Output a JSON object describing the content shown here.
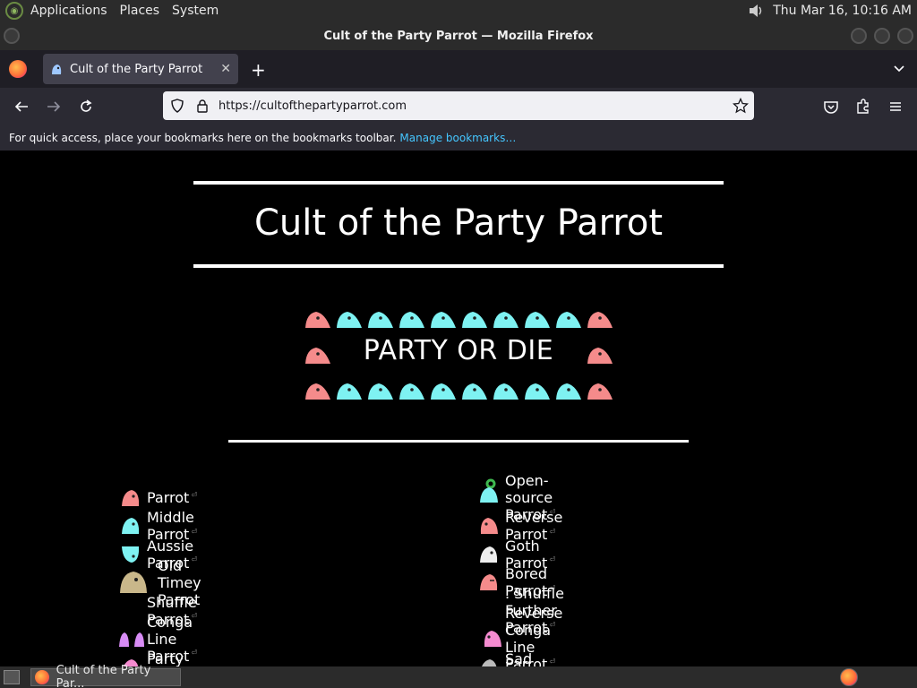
{
  "system_panel": {
    "menus": [
      "Applications",
      "Places",
      "System"
    ],
    "clock": "Thu Mar 16, 10:16 AM"
  },
  "window": {
    "title": "Cult of the Party Parrot — Mozilla Firefox"
  },
  "browser": {
    "tab_title": "Cult of the Party Parrot",
    "url": "https://cultofthepartyparrot.com",
    "bookmarks_hint": "For quick access, place your bookmarks here on the bookmarks toolbar.",
    "manage_bookmarks": "Manage bookmarks…"
  },
  "page": {
    "title": "Cult of the Party Parrot",
    "banner": "PARTY OR DIE",
    "left_list": [
      "Parrot",
      "Middle Parrot",
      "Aussie Parrot",
      "Old Timey Parrot",
      "Shuffle Parrot",
      "Conga Line Parrot",
      "Party Parrot"
    ],
    "right_list": [
      "Open-source Parrot",
      "Reverse Parrot",
      "Goth Parrot",
      "Bored Parrot",
      "Shuffle Further Parrot",
      "Reverse Conga Line Parrot",
      "Sad Parrot"
    ]
  },
  "taskbar": {
    "task_label": "Cult of the Party Par..."
  },
  "colors": {
    "parrot_pink": "#f58b8b",
    "parrot_cyan": "#7ef2f2",
    "link_blue": "#45c6ff"
  }
}
